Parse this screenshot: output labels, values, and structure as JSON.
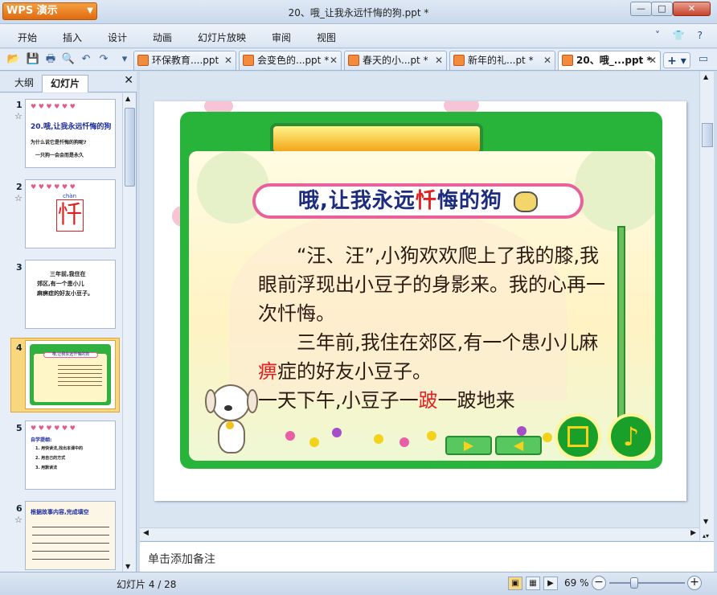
{
  "app": {
    "logo": "WPS 演示",
    "window_title": "20、哦_让我永远忏悔的狗.ppt *"
  },
  "menu": [
    "开始",
    "插入",
    "设计",
    "动画",
    "幻灯片放映",
    "审阅",
    "视图"
  ],
  "tabs": [
    {
      "label": "环保教育....ppt"
    },
    {
      "label": "会变色的...ppt *"
    },
    {
      "label": "春天的小...pt *"
    },
    {
      "label": "新年的礼...pt *"
    },
    {
      "label": "20、哦_...ppt *"
    }
  ],
  "side_panel": {
    "tab_outline": "大纲",
    "tab_slides": "幻灯片",
    "thumbnails": [
      {
        "num": "1",
        "lines": [
          "20.哦,让我永远忏悔的狗",
          "为什么说它是忏悔的狗呢?",
          "一只狗一会会而是永久"
        ]
      },
      {
        "num": "2",
        "lines": [
          "chàn",
          "忏"
        ]
      },
      {
        "num": "3",
        "lines": [
          "三年前,我住在",
          "郊区,有一个患小儿",
          "麻痹症的好友小豆子。"
        ]
      },
      {
        "num": "4",
        "lines": [
          "哦,让我永远忏悔的狗"
        ]
      },
      {
        "num": "5",
        "lines": [
          "自学提纲:",
          "1. 用快读法,找出本课中的",
          "2. 用自己的方式",
          "3. 用默读法"
        ]
      },
      {
        "num": "6",
        "lines": [
          "根据故事内容,完成填空"
        ]
      }
    ]
  },
  "slide": {
    "title_parts": [
      "哦,让我永远",
      "忏",
      "悔的狗"
    ],
    "paragraph1": "“汪、汪”,小狗欢欢爬上了我的膝,我眼前浮现出小豆子的身影来。我的心再一次忏悔。",
    "paragraph2_parts": [
      "三年前,我住在郊区,有一个患小儿麻",
      "痹",
      "症的好友小豆子。"
    ],
    "paragraph3_parts": [
      "一天下午,小豆子一",
      "跛",
      "一跛地来"
    ]
  },
  "notes_placeholder": "单击添加备注",
  "status": {
    "slide_counter": "幻灯片 4 / 28",
    "zoom": "69 %"
  }
}
